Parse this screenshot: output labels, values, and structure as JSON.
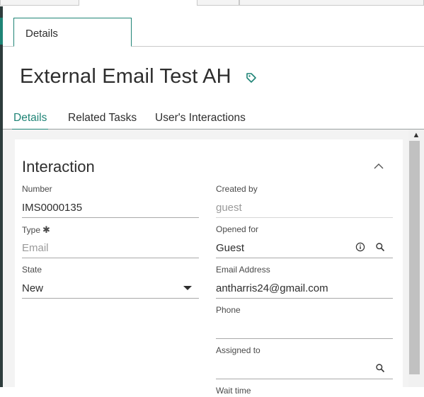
{
  "workspace_tab": {
    "label": "Details"
  },
  "record": {
    "title": "External Email Test AH"
  },
  "record_tabs": [
    {
      "label": "Details",
      "active": true
    },
    {
      "label": "Related Tasks",
      "active": false
    },
    {
      "label": "User's Interactions",
      "active": false
    }
  ],
  "section": {
    "title": "Interaction"
  },
  "fields": {
    "number": {
      "label": "Number",
      "value": "IMS0000135"
    },
    "created_by": {
      "label": "Created by",
      "value": "guest"
    },
    "type": {
      "label": "Type",
      "required_mark": "✱",
      "placeholder": "Email"
    },
    "opened_for": {
      "label": "Opened for",
      "value": "Guest"
    },
    "state": {
      "label": "State",
      "value": "New"
    },
    "email_address": {
      "label": "Email Address",
      "value": "antharris24@gmail.com"
    },
    "phone": {
      "label": "Phone",
      "value": ""
    },
    "assigned_to": {
      "label": "Assigned to",
      "value": ""
    },
    "wait_time": {
      "label": "Wait time"
    }
  },
  "colors": {
    "accent": "#1f8476",
    "sidebar": "#2e3d3d"
  },
  "icons": [
    "tag-icon",
    "chevron-up-icon",
    "info-icon",
    "search-icon",
    "caret-down-icon"
  ]
}
